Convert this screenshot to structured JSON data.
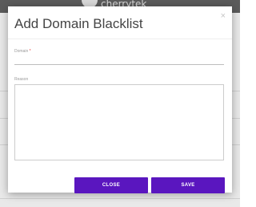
{
  "backdrop": {
    "brand_text": "cherrytek"
  },
  "modal": {
    "title": "Add Domain Blacklist",
    "close_glyph": "×",
    "domain": {
      "label": "Domain",
      "required_marker": "*",
      "value": "",
      "placeholder": ""
    },
    "reason": {
      "label": "Reason",
      "value": "",
      "placeholder": ""
    },
    "buttons": {
      "close_label": "CLOSE",
      "save_label": "SAVE"
    }
  },
  "colors": {
    "primary_button": "#5a16bf",
    "required_marker": "#e53935",
    "title_text": "#444444"
  },
  "icons": {
    "close": "close-icon",
    "logo": "logo-icon"
  }
}
